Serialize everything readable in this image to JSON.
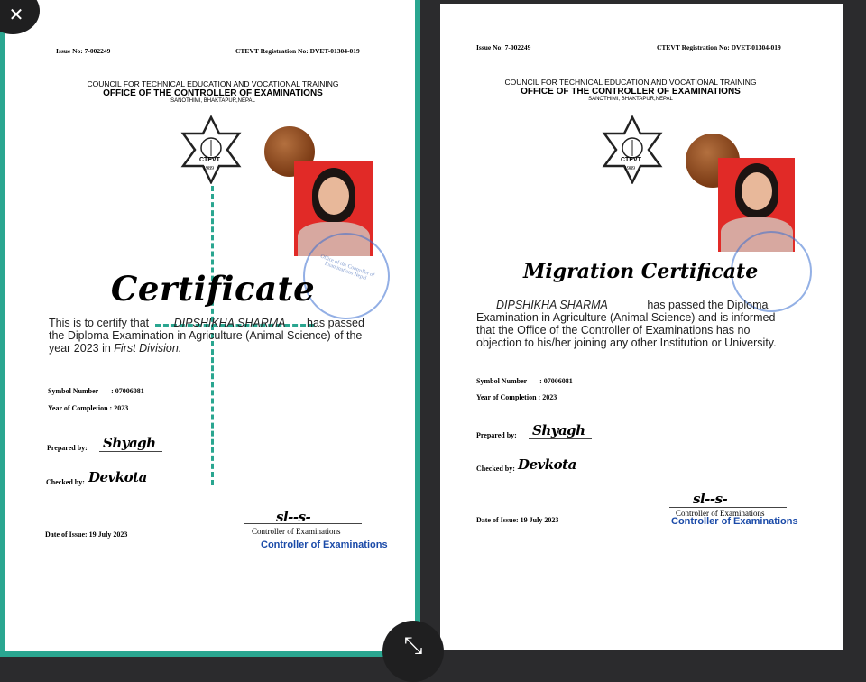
{
  "certificate": {
    "issue_no": "Issue No: 7-002249",
    "registration_no": "CTEVT Registration No: DVET-01304-019",
    "council": "COUNCIL FOR TECHNICAL EDUCATION AND VOCATIONAL TRAINING",
    "office": "OFFICE OF THE CONTROLLER OF EXAMINATIONS",
    "address": "SANOTHIMI, BHAKTAPUR,NEPAL",
    "logo_text": "CTEVT",
    "logo_year": "1989",
    "title": "Certificate",
    "body_prefix": "This is to certify that",
    "name": "DIPSHIKHA SHARMA",
    "body_line1_suffix": "has passed",
    "body_line2": "the Diploma Examination in Agriculture (Animal Science) of the",
    "body_line3_prefix": "year 2023 in",
    "division": "First Division.",
    "symbol_label": "Symbol Number",
    "symbol_value": ": 07006081",
    "year_label": "Year of Completion :",
    "year_value": "2023",
    "prepared_label": "Prepared by:",
    "prepared_sig": "Shyagh",
    "checked_label": "Checked by:",
    "checked_sig": "Devkota",
    "date_label": "Date of Issue:",
    "date_value": "19 July 2023",
    "controller_sig": "sl--s-",
    "controller_title": "Controller of Examinations",
    "controller_stamp": "Controller of Examinations",
    "stamp_text": "Office of the Controller of Examinations Nepal"
  },
  "migration": {
    "issue_no": "Issue No: 7-002249",
    "registration_no": "CTEVT Registration No: DVET-01304-019",
    "council": "COUNCIL FOR TECHNICAL EDUCATION AND VOCATIONAL TRAINING",
    "office": "OFFICE OF THE CONTROLLER OF EXAMINATIONS",
    "address": "SANOTHIMI, BHAKTAPUR,NEPAL",
    "logo_text": "CTEVT",
    "logo_year": "1989",
    "title": "Migration Certificate",
    "name": "DIPSHIKHA SHARMA",
    "body_line1_suffix": "has passed the Diploma",
    "body_line2": "Examination in Agriculture (Animal Science) and is informed",
    "body_line3": "that the Office of the Controller of Examinations has no",
    "body_line4": "objection to his/her joining any other Institution or University.",
    "symbol_label": "Symbol Number",
    "symbol_value": ": 07006081",
    "year_label": "Year of Completion :",
    "year_value": "2023",
    "prepared_label": "Prepared by:",
    "prepared_sig": "Shyagh",
    "checked_label": "Checked by:",
    "checked_sig": "Devkota",
    "date_label": "Date of Issue:",
    "date_value": "19 July 2023",
    "controller_sig": "sl--s-",
    "controller_title": "Controller of Examinations",
    "controller_stamp": "Controller of Examinations"
  },
  "controls": {
    "close_glyph": "✕",
    "expand_glyph": "⤡"
  },
  "colors": {
    "selection_border": "#2aa690",
    "stamp_blue": "#1a4aa8",
    "photo_bg": "#e12a27"
  }
}
